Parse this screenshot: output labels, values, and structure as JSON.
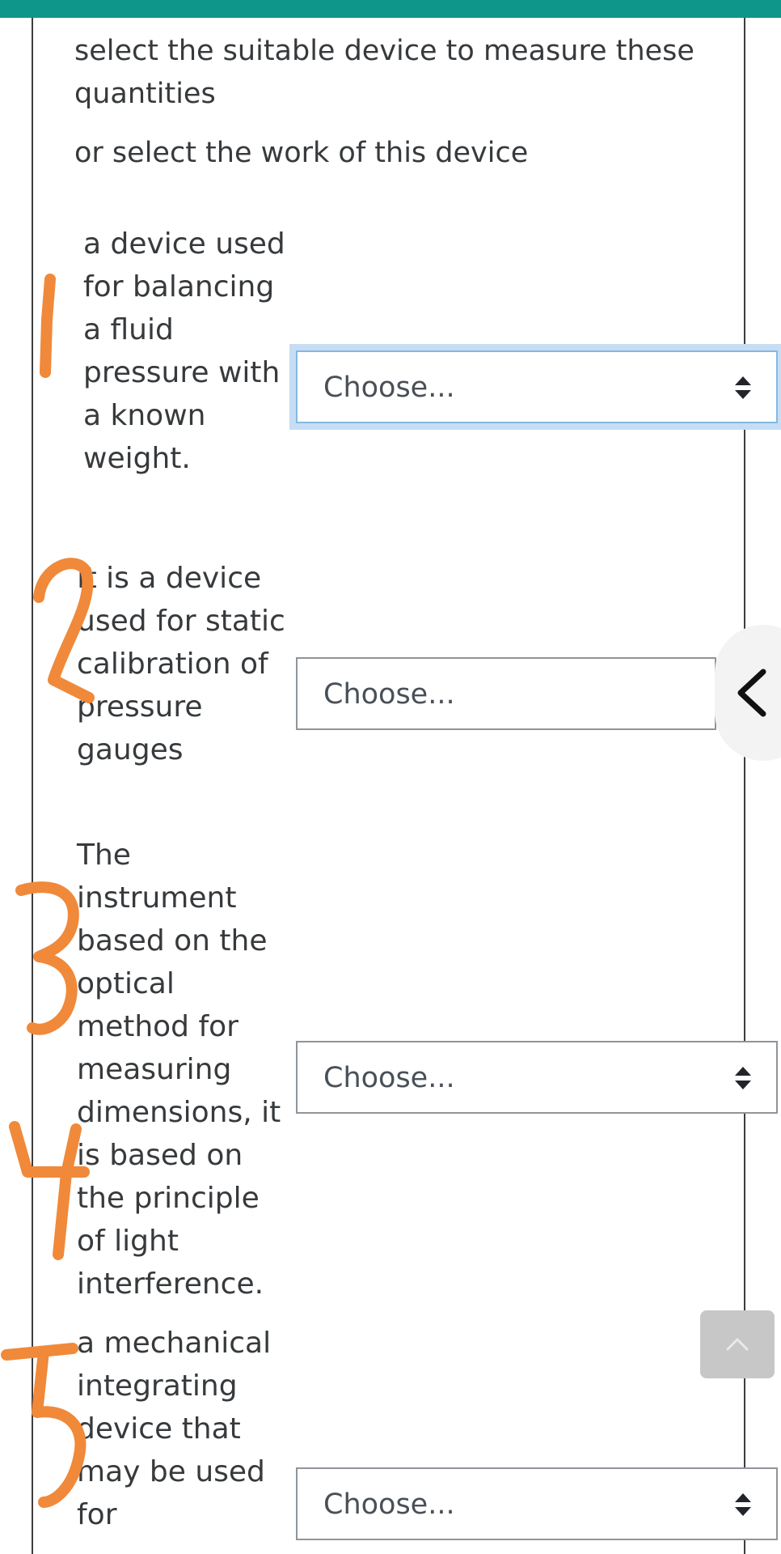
{
  "intro": {
    "line1": "select the suitable device to measure these quantities",
    "line2": "or select the work of this device"
  },
  "questions": [
    {
      "text": " a device used for balancing a fluid pressure with a known weight.",
      "select_value": "Choose..."
    },
    {
      "text": "It is a device used for static calibration of pressure gauges",
      "select_value": "Choose..."
    },
    {
      "text": "The instrument based on the optical method  for measuring dimensions, it is based on the principle of light interference.",
      "select_value": "Choose..."
    },
    {
      "text": "a mechanical integrating device that may be used for",
      "select_value": "Choose..."
    }
  ],
  "colors": {
    "topbar": "#0f968a",
    "annotation": "#f0893a",
    "focus_ring": "#c6ddf3"
  },
  "icons": {
    "select_arrows": "up-down-caret-icon",
    "sidebar_toggle": "chevron-left-icon",
    "back_to_top": "chevron-up-icon"
  }
}
